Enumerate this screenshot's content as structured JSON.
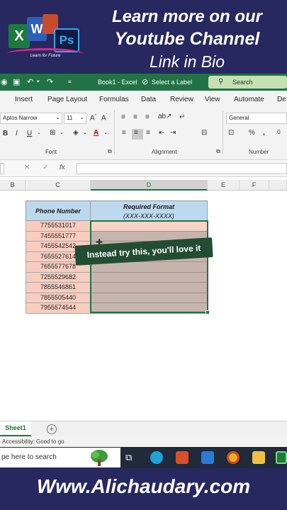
{
  "banner": {
    "line1": "Learn more on our",
    "line2": "Youtube Channel",
    "line3": "Link in Bio",
    "logo_tagline": "Learn for Future",
    "logo_letters": {
      "x": "X",
      "w": "W",
      "ps": "Ps"
    }
  },
  "titlebar": {
    "workbook": "Book1 - Excel",
    "label_prompt": "Select a Label",
    "search_placeholder": "Search"
  },
  "ribbon_tabs": [
    "Insert",
    "Page Layout",
    "Formulas",
    "Data",
    "Review",
    "View",
    "Automate",
    "De"
  ],
  "ribbon": {
    "font_name": "Aptos Narrow",
    "font_size": "11",
    "number_format": "General",
    "groups": {
      "font": "Font",
      "alignment": "Alignment",
      "number": "Number"
    }
  },
  "formula_bar": {
    "fx": "fx"
  },
  "columns": [
    "B",
    "C",
    "D",
    "E",
    "F"
  ],
  "table": {
    "header_phone": "Phone Number",
    "header_format_l1": "Required Format",
    "header_format_l2": "(XXX-XXX-XXXX)",
    "phones": [
      "7755531017",
      "7455551777",
      "7455542542",
      "7655527614",
      "7655577678",
      "7255529682",
      "7855546861",
      "7855505440",
      "7955574544"
    ]
  },
  "caption": "Instead try this, you'll love it",
  "sheet_tabs": {
    "active": "Sheet1",
    "add": "+"
  },
  "status": {
    "accessibility": "Accessibility: Good to go"
  },
  "taskbar": {
    "search_placeholder": "pe here to search"
  },
  "footer": {
    "url": "Www.Alichaudary.com"
  },
  "colors": {
    "banner_bg": "#27285f",
    "excel_green": "#217346",
    "header_blue": "#bcd9ee",
    "phone_fill": "#f8cdbf",
    "selection_fill": "#c6b5ad"
  }
}
